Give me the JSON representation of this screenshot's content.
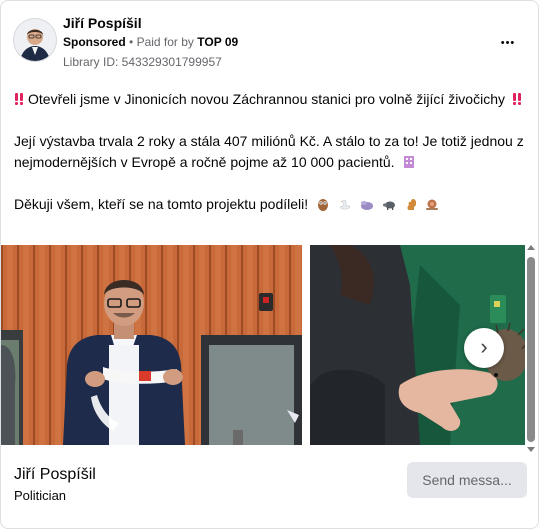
{
  "post": {
    "author": "Jiří Pospíšil",
    "sponsored_label": "Sponsored",
    "separator": "•",
    "paid_for_prefix": "Paid for by",
    "paid_for_by": "TOP 09",
    "library_id": "Library ID: 543329301799957",
    "more_icon": "more-dots-icon",
    "more_glyph": "•••",
    "text": {
      "line1": "Otevřeli jsme v Jinonicích novou Záchrannou stanici pro volně žijící živočichy",
      "line2": "Její výstavba trvala 2 roky a stála 407 miliónů Kč. A stálo to za to! Je totiž jednou z nejmodernějších v Evropě a ročně pojme až 10 000 pacientů.",
      "line3": "Děkuji všem, kteří se na tomto projektu podíleli!"
    },
    "emojis": {
      "exclamation": "double-exclamation-icon",
      "building": "building-icon",
      "animals": [
        "owl-icon",
        "swan-icon",
        "hedgehog-icon",
        "boar-icon",
        "squirrel-icon",
        "snail-icon"
      ]
    }
  },
  "carousel": {
    "slides": [
      {
        "description_icon": "photo-man-cutting-ribbon"
      },
      {
        "description_icon": "photo-hand-holding-hedgehog"
      }
    ],
    "next_glyph": "›"
  },
  "footer": {
    "name": "Jiří Pospíšil",
    "subtitle": "Politician",
    "send_button": "Send messa..."
  },
  "colors": {
    "accent_text": "#65676b",
    "button_bg": "#e4e6eb",
    "emoji_red": "#e0245e"
  }
}
